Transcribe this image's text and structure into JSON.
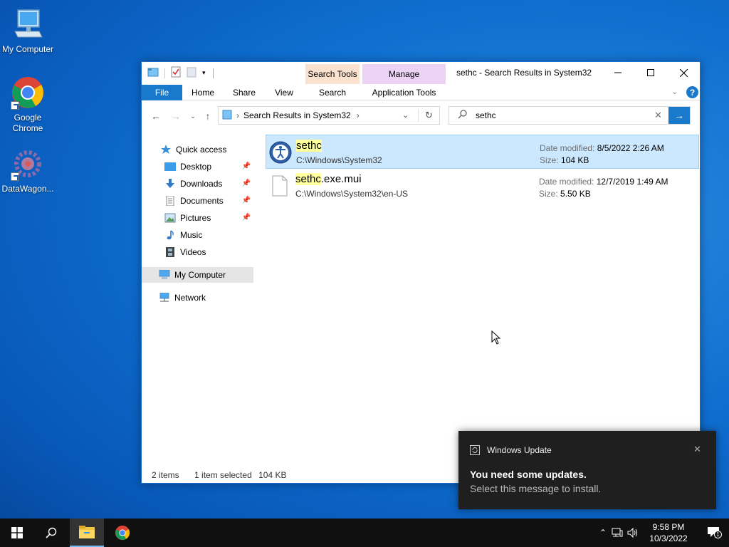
{
  "desktop": {
    "icons": [
      {
        "label": "My Computer"
      },
      {
        "label": "Google Chrome"
      },
      {
        "label": "DataWagon..."
      }
    ]
  },
  "window": {
    "title": "sethc - Search Results in System32",
    "contextual_tabs": {
      "search_tools": "Search Tools",
      "manage": "Manage",
      "search": "Search",
      "application_tools": "Application Tools"
    },
    "ribbon_tabs": {
      "file": "File",
      "home": "Home",
      "share": "Share",
      "view": "View"
    },
    "address": {
      "path": "Search Results in System32",
      "separator": "›"
    },
    "search": {
      "query": "sethc"
    },
    "nav_pane": {
      "quick_access": "Quick access",
      "items": [
        {
          "label": "Desktop"
        },
        {
          "label": "Downloads"
        },
        {
          "label": "Documents"
        },
        {
          "label": "Pictures"
        },
        {
          "label": "Music"
        },
        {
          "label": "Videos"
        }
      ],
      "my_computer": "My Computer",
      "network": "Network"
    },
    "results": [
      {
        "name_highlight": "sethc",
        "name_rest": "",
        "path": "C:\\Windows\\System32",
        "date_label": "Date modified:",
        "date": "8/5/2022 2:26 AM",
        "size_label": "Size:",
        "size": "104 KB"
      },
      {
        "name_highlight": "sethc",
        "name_rest": ".exe.mui",
        "path": "C:\\Windows\\System32\\en-US",
        "date_label": "Date modified:",
        "date": "12/7/2019 1:49 AM",
        "size_label": "Size:",
        "size": "5.50 KB"
      }
    ],
    "status": {
      "item_count": "2 items",
      "selection": "1 item selected",
      "selection_size": "104 KB"
    }
  },
  "notification": {
    "app": "Windows Update",
    "title": "You need some updates.",
    "body": "Select this message to install."
  },
  "taskbar": {
    "time": "9:58 PM",
    "date": "10/3/2022",
    "notification_count": "1"
  },
  "colors": {
    "accent": "#1979ca",
    "selection_bg": "#cce8ff",
    "highlight": "#ffff9c",
    "search_tools_bg": "#fbe2cf",
    "manage_bg": "#ecd3f5"
  }
}
